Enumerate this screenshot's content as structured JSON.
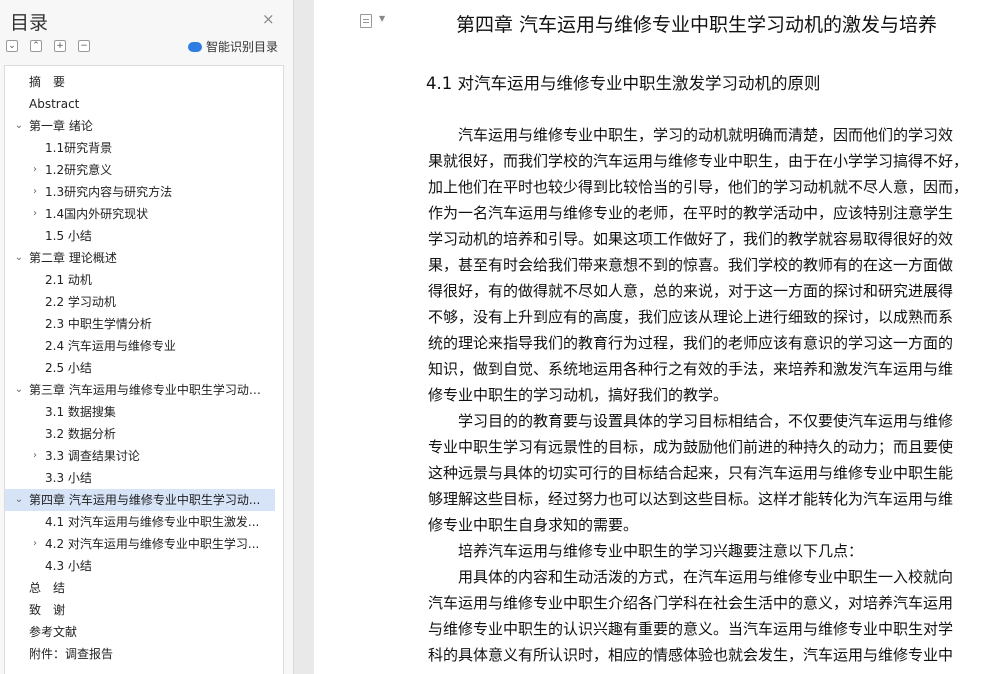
{
  "sidebar": {
    "title": "目录",
    "close_glyph": "×",
    "smart_toc_label": "智能识别目录",
    "tools": [
      {
        "name": "collapse-all-icon",
        "glyph": "⌄"
      },
      {
        "name": "expand-all-icon",
        "glyph": "⌃"
      },
      {
        "name": "add-level-icon",
        "glyph": "+"
      },
      {
        "name": "remove-level-icon",
        "glyph": "−"
      }
    ],
    "toc_items": [
      {
        "label": "摘　要",
        "level": 1,
        "arrow": ""
      },
      {
        "label": "Abstract",
        "level": 1,
        "arrow": ""
      },
      {
        "label": "第一章  绪论",
        "level": 1,
        "arrow": "v"
      },
      {
        "label": "1.1研究背景",
        "level": 2,
        "arrow": ""
      },
      {
        "label": "1.2研究意义",
        "level": 2,
        "arrow": ">"
      },
      {
        "label": "1.3研究内容与研究方法",
        "level": 2,
        "arrow": ">"
      },
      {
        "label": "1.4国内外研究现状",
        "level": 2,
        "arrow": ">"
      },
      {
        "label": "1.5 小结",
        "level": 2,
        "arrow": ""
      },
      {
        "label": "第二章  理论概述",
        "level": 1,
        "arrow": "v"
      },
      {
        "label": "2.1 动机",
        "level": 2,
        "arrow": ""
      },
      {
        "label": "2.2 学习动机",
        "level": 2,
        "arrow": ""
      },
      {
        "label": "2.3 中职生学情分析",
        "level": 2,
        "arrow": ""
      },
      {
        "label": "2.4 汽车运用与维修专业",
        "level": 2,
        "arrow": ""
      },
      {
        "label": "2.5 小结",
        "level": 2,
        "arrow": ""
      },
      {
        "label": "第三章  汽车运用与维修专业中职生学习动机...",
        "level": 1,
        "arrow": "v"
      },
      {
        "label": "3.1 数据搜集",
        "level": 2,
        "arrow": ""
      },
      {
        "label": "3.2 数据分析",
        "level": 2,
        "arrow": ""
      },
      {
        "label": "3.3 调查结果讨论",
        "level": 2,
        "arrow": ">"
      },
      {
        "label": "3.3 小结",
        "level": 2,
        "arrow": ""
      },
      {
        "label": "第四章  汽车运用与维修专业中职生学习动...",
        "level": 1,
        "arrow": "v",
        "active": true
      },
      {
        "label": "4.1 对汽车运用与维修专业中职生激发...",
        "level": 2,
        "arrow": ""
      },
      {
        "label": "4.2 对汽车运用与维修专业中职生学习...",
        "level": 2,
        "arrow": ">"
      },
      {
        "label": "4.3 小结",
        "level": 2,
        "arrow": ""
      },
      {
        "label": "总　结",
        "level": 1,
        "arrow": ""
      },
      {
        "label": "致　谢",
        "level": 1,
        "arrow": ""
      },
      {
        "label": "参考文献",
        "level": 1,
        "arrow": ""
      },
      {
        "label": "附件：调查报告",
        "level": 1,
        "arrow": ""
      }
    ]
  },
  "document": {
    "chapter_title": "第四章  汽车运用与维修专业中职生学习动机的激发与培养",
    "section_title": "4.1 对汽车运用与维修专业中职生激发学习动机的原则",
    "lines": [
      "　　汽车运用与维修专业中职生，学习的动机就明确而清楚，因而他们的学习效",
      "果就很好，而我们学校的汽车运用与维修专业中职生，由于在小学学习搞得不好，",
      "加上他们在平时也较少得到比较恰当的引导，他们的学习动机就不尽人意，因而，",
      "作为一名汽车运用与维修专业的老师，在平时的教学活动中，应该特别注意学生",
      "学习动机的培养和引导。如果这项工作做好了，我们的教学就容易取得很好的效",
      "果，甚至有时会给我们带来意想不到的惊喜。我们学校的教师有的在这一方面做",
      "得很好，有的做得就不尽如人意，总的来说，对于这一方面的探讨和研究进展得",
      "不够，没有上升到应有的高度，我们应该从理论上进行细致的探讨，以成熟而系",
      "统的理论来指导我们的教育行为过程，我们的老师应该有意识的学习这一方面的",
      "知识，做到自觉、系统地运用各种行之有效的手法，来培养和激发汽车运用与维",
      "修专业中职生的学习动机，搞好我们的教学。",
      "　　学习目的的教育要与设置具体的学习目标相结合，不仅要使汽车运用与维修",
      "专业中职生学习有远景性的目标，成为鼓励他们前进的种持久的动力；而且要使",
      "这种远景与具体的切实可行的目标结合起来，只有汽车运用与维修专业中职生能",
      "够理解这些目标，经过努力也可以达到这些目标。这样才能转化为汽车运用与维",
      "修专业中职生自身求知的需要。",
      "　　培养汽车运用与维修专业中职生的学习兴趣要注意以下几点：",
      "　　用具体的内容和生动活泼的方式，在汽车运用与维修专业中职生一入校就向",
      "汽车运用与维修专业中职生介绍各门学科在社会生活中的意义，对培养汽车运用",
      "与维修专业中职生的认识兴趣有重要的意义。当汽车运用与维修专业中职生对学",
      "科的具体意义有所认识时，相应的情感体验也就会发生，汽车运用与维修专业中"
    ]
  }
}
